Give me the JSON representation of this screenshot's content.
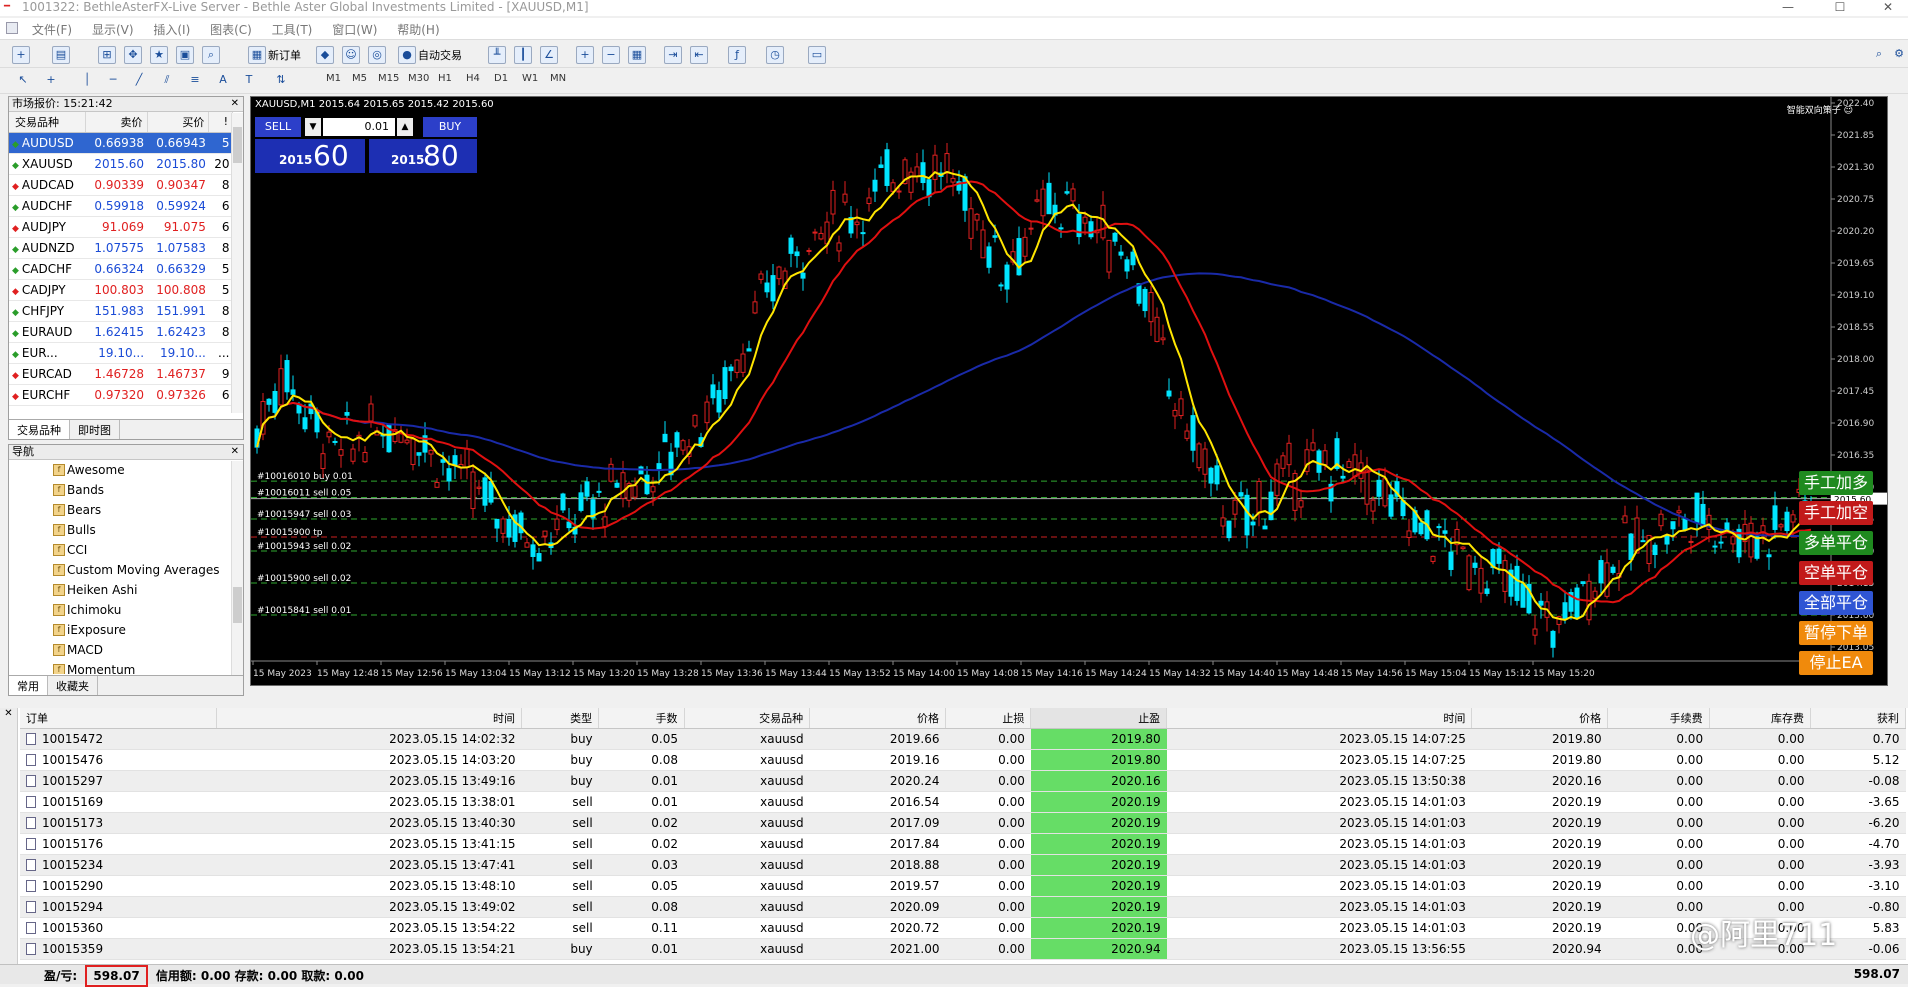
{
  "window": {
    "title": "1001322: BethleAsterFX-Live Server - Bethle Aster Global Investments Limited - [XAUUSD,M1]"
  },
  "menu": [
    "文件(F)",
    "显示(V)",
    "插入(I)",
    "图表(C)",
    "工具(T)",
    "窗口(W)",
    "帮助(H)"
  ],
  "toolbar": {
    "new_order": "新订单",
    "auto_trading": "自动交易"
  },
  "timeframes": [
    "M1",
    "M5",
    "M15",
    "M30",
    "H1",
    "H4",
    "D1",
    "W1",
    "MN"
  ],
  "market_watch": {
    "title": "市场报价: 15:21:42",
    "headers": [
      "交易品种",
      "卖价",
      "买价",
      "!"
    ],
    "rows": [
      {
        "symbol": "AUDUSD",
        "bid": "0.66938",
        "ask": "0.66943",
        "sp": "5",
        "dir": "up"
      },
      {
        "symbol": "XAUUSD",
        "bid": "2015.60",
        "ask": "2015.80",
        "sp": "20",
        "dir": "up"
      },
      {
        "symbol": "AUDCAD",
        "bid": "0.90339",
        "ask": "0.90347",
        "sp": "8",
        "dir": "down"
      },
      {
        "symbol": "AUDCHF",
        "bid": "0.59918",
        "ask": "0.59924",
        "sp": "6",
        "dir": "up"
      },
      {
        "symbol": "AUDJPY",
        "bid": "91.069",
        "ask": "91.075",
        "sp": "6",
        "dir": "down"
      },
      {
        "symbol": "AUDNZD",
        "bid": "1.07575",
        "ask": "1.07583",
        "sp": "8",
        "dir": "up"
      },
      {
        "symbol": "CADCHF",
        "bid": "0.66324",
        "ask": "0.66329",
        "sp": "5",
        "dir": "up"
      },
      {
        "symbol": "CADJPY",
        "bid": "100.803",
        "ask": "100.808",
        "sp": "5",
        "dir": "down"
      },
      {
        "symbol": "CHFJPY",
        "bid": "151.983",
        "ask": "151.991",
        "sp": "8",
        "dir": "up"
      },
      {
        "symbol": "EURAUD",
        "bid": "1.62415",
        "ask": "1.62423",
        "sp": "8",
        "dir": "up"
      },
      {
        "symbol": "EUR...",
        "bid": "19.10...",
        "ask": "19.10...",
        "sp": "...",
        "dir": "up"
      },
      {
        "symbol": "EURCAD",
        "bid": "1.46728",
        "ask": "1.46737",
        "sp": "9",
        "dir": "down"
      },
      {
        "symbol": "EURCHF",
        "bid": "0.97320",
        "ask": "0.97326",
        "sp": "6",
        "dir": "down"
      }
    ],
    "tabs": [
      "交易品种",
      "即时图"
    ]
  },
  "navigator": {
    "title": "导航",
    "items": [
      "Awesome",
      "Bands",
      "Bears",
      "Bulls",
      "CCI",
      "Custom Moving Averages",
      "Heiken Ashi",
      "Ichimoku",
      "iExposure",
      "MACD",
      "Momentum"
    ],
    "tabs": [
      "常用",
      "收藏夹"
    ]
  },
  "chart": {
    "header": "XAUUSD,M1  2015.64 2015.65 2015.42 2015.60",
    "corner_label": "智能双向策子 ☺",
    "one_click": {
      "sell_label": "SELL",
      "buy_label": "BUY",
      "lot": "0.01",
      "sell_small": "2015",
      "sell_big": "60",
      "buy_small": "2015",
      "buy_big": "80"
    },
    "price_ticks": [
      "2022.40",
      "2021.85",
      "2021.30",
      "2020.75",
      "2020.20",
      "2019.65",
      "2019.10",
      "2018.55",
      "2018.00",
      "2017.45",
      "2016.90",
      "2016.35",
      "2015.80",
      "2015.60",
      "2015.25",
      "2014.70",
      "2014.15",
      "2013.60",
      "2013.05"
    ],
    "time_ticks": [
      "15 May 2023",
      "15 May 12:48",
      "15 May 12:56",
      "15 May 13:04",
      "15 May 13:12",
      "15 May 13:20",
      "15 May 13:28",
      "15 May 13:36",
      "15 May 13:44",
      "15 May 13:52",
      "15 May 14:00",
      "15 May 14:08",
      "15 May 14:16",
      "15 May 14:24",
      "15 May 14:32",
      "15 May 14:40",
      "15 May 14:48",
      "15 May 14:56",
      "15 May 15:04",
      "15 May 15:12",
      "15 May 15:20"
    ],
    "order_lines": [
      {
        "label": "#10016010 buy 0.01",
        "price": 2015.9,
        "color": "#2fa82f"
      },
      {
        "label": "#10016011 sell 0.05",
        "price": 2015.62,
        "color": "#2fa82f"
      },
      {
        "label": "#10015947 sell 0.03",
        "price": 2015.25,
        "color": "#2fa82f"
      },
      {
        "label": "#10015900 tp",
        "price": 2014.94,
        "color": "#cc2020"
      },
      {
        "label": "#10015943 sell 0.02",
        "price": 2014.7,
        "color": "#2fa82f"
      },
      {
        "label": "#10015900 sell 0.02",
        "price": 2014.15,
        "color": "#2fa82f"
      },
      {
        "label": "#10015841 sell 0.01",
        "price": 2013.6,
        "color": "#2fa82f"
      }
    ],
    "ea_buttons": [
      {
        "label": "手工加多",
        "color": "#1f8a1f"
      },
      {
        "label": "手工加空",
        "color": "#c21a1a"
      },
      {
        "label": "多单平仓",
        "color": "#1f8a1f"
      },
      {
        "label": "空单平仓",
        "color": "#c21a1a"
      },
      {
        "label": "全部平仓",
        "color": "#2f55d4"
      },
      {
        "label": "暂停下单",
        "color": "#f08a0c"
      },
      {
        "label": "停止EA",
        "color": "#f08a0c"
      }
    ]
  },
  "terminal": {
    "headers": [
      "订单",
      "时间",
      "类型",
      "手数",
      "交易品种",
      "价格",
      "止损",
      "止盈",
      "时间",
      "价格",
      "手续费",
      "库存费",
      "获利"
    ],
    "rows": [
      [
        "10015472",
        "2023.05.15 14:02:32",
        "buy",
        "0.05",
        "xauusd",
        "2019.66",
        "0.00",
        "2019.80",
        "2023.05.15 14:07:25",
        "2019.80",
        "0.00",
        "0.00",
        "0.70"
      ],
      [
        "10015476",
        "2023.05.15 14:03:20",
        "buy",
        "0.08",
        "xauusd",
        "2019.16",
        "0.00",
        "2019.80",
        "2023.05.15 14:07:25",
        "2019.80",
        "0.00",
        "0.00",
        "5.12"
      ],
      [
        "10015297",
        "2023.05.15 13:49:16",
        "buy",
        "0.01",
        "xauusd",
        "2020.24",
        "0.00",
        "2020.16",
        "2023.05.15 13:50:38",
        "2020.16",
        "0.00",
        "0.00",
        "-0.08"
      ],
      [
        "10015169",
        "2023.05.15 13:38:01",
        "sell",
        "0.01",
        "xauusd",
        "2016.54",
        "0.00",
        "2020.19",
        "2023.05.15 14:01:03",
        "2020.19",
        "0.00",
        "0.00",
        "-3.65"
      ],
      [
        "10015173",
        "2023.05.15 13:40:30",
        "sell",
        "0.02",
        "xauusd",
        "2017.09",
        "0.00",
        "2020.19",
        "2023.05.15 14:01:03",
        "2020.19",
        "0.00",
        "0.00",
        "-6.20"
      ],
      [
        "10015176",
        "2023.05.15 13:41:15",
        "sell",
        "0.02",
        "xauusd",
        "2017.84",
        "0.00",
        "2020.19",
        "2023.05.15 14:01:03",
        "2020.19",
        "0.00",
        "0.00",
        "-4.70"
      ],
      [
        "10015234",
        "2023.05.15 13:47:41",
        "sell",
        "0.03",
        "xauusd",
        "2018.88",
        "0.00",
        "2020.19",
        "2023.05.15 14:01:03",
        "2020.19",
        "0.00",
        "0.00",
        "-3.93"
      ],
      [
        "10015290",
        "2023.05.15 13:48:10",
        "sell",
        "0.05",
        "xauusd",
        "2019.57",
        "0.00",
        "2020.19",
        "2023.05.15 14:01:03",
        "2020.19",
        "0.00",
        "0.00",
        "-3.10"
      ],
      [
        "10015294",
        "2023.05.15 13:49:02",
        "sell",
        "0.08",
        "xauusd",
        "2020.09",
        "0.00",
        "2020.19",
        "2023.05.15 14:01:03",
        "2020.19",
        "0.00",
        "0.00",
        "-0.80"
      ],
      [
        "10015360",
        "2023.05.15 13:54:22",
        "sell",
        "0.11",
        "xauusd",
        "2020.72",
        "0.00",
        "2020.19",
        "2023.05.15 14:01:03",
        "2020.19",
        "0.00",
        "0.00",
        "5.83"
      ],
      [
        "10015359",
        "2023.05.15 13:54:21",
        "buy",
        "0.01",
        "xauusd",
        "2021.00",
        "0.00",
        "2020.94",
        "2023.05.15 13:56:55",
        "2020.94",
        "0.00",
        "0.00",
        "-0.06"
      ]
    ],
    "status": {
      "pl_label": "盈/亏:",
      "pl_value": "598.07",
      "rest": "信用额: 0.00  存款: 0.00  取款: 0.00",
      "total": "598.07"
    }
  },
  "watermark": "@阿里711"
}
